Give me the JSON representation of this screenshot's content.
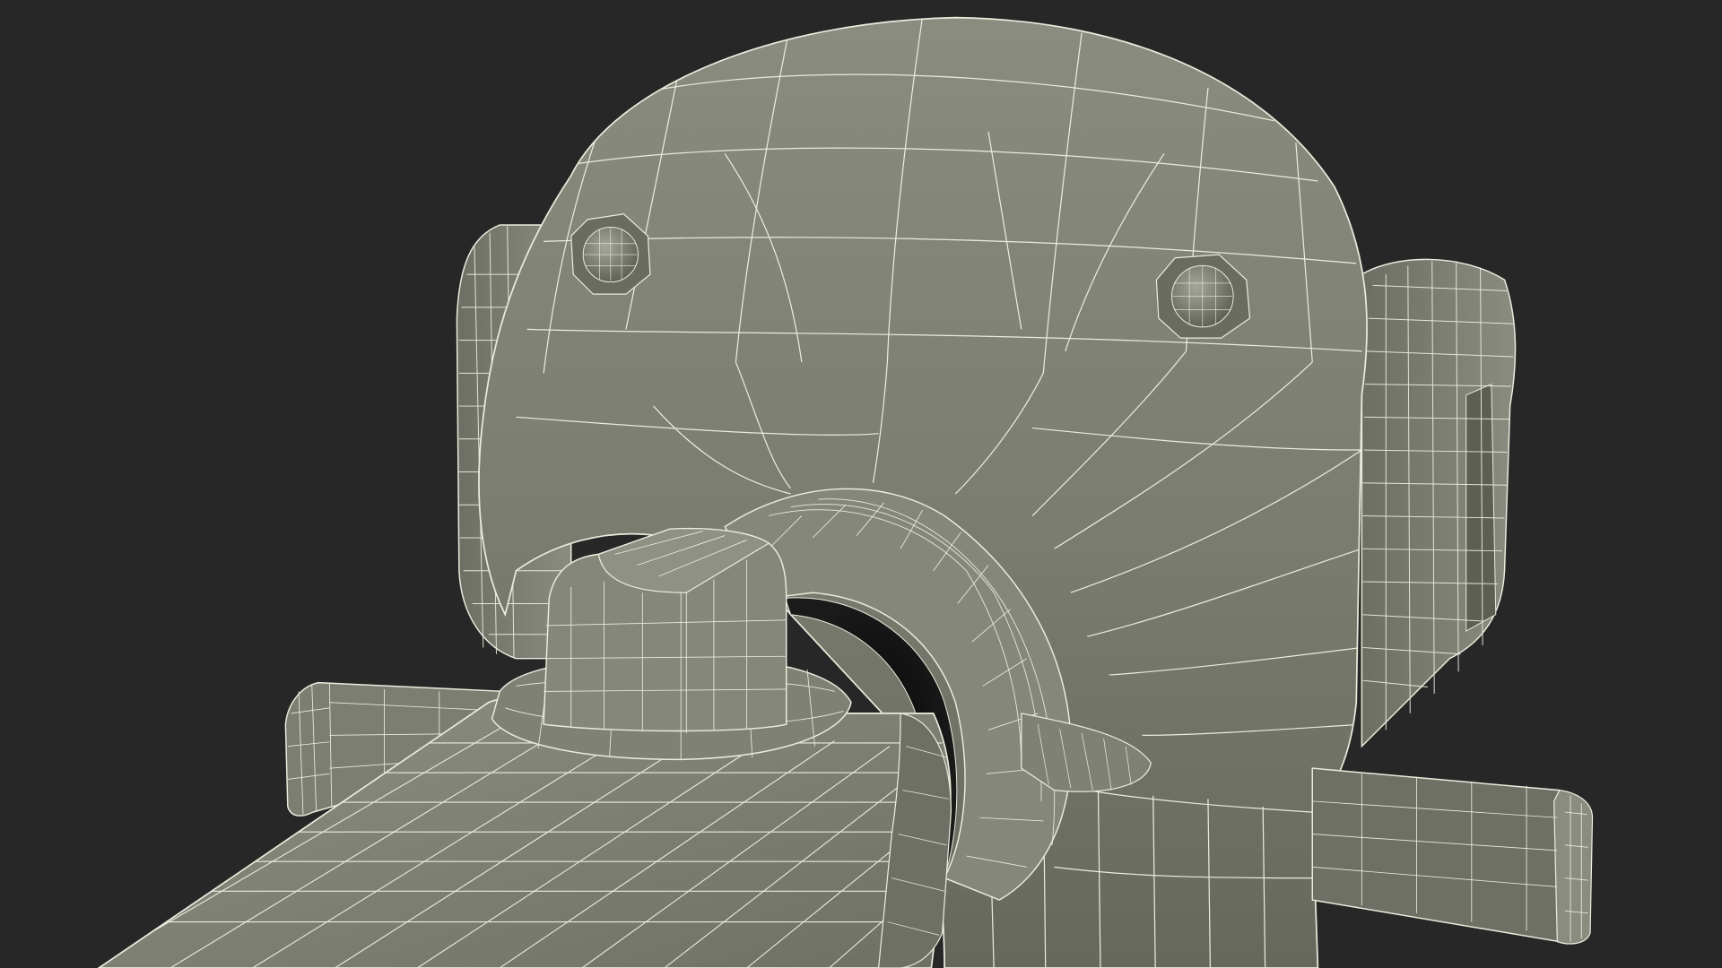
{
  "scene": {
    "background_color": "#272727",
    "surface_color": "#7c7e72",
    "surface_shadow_color": "#55574e",
    "surface_dark_color": "#3e3f38",
    "bore_color": "#0f0f0f",
    "wire_color": "#ecebdd",
    "subject": "wireframe-ct-scanner-model"
  }
}
